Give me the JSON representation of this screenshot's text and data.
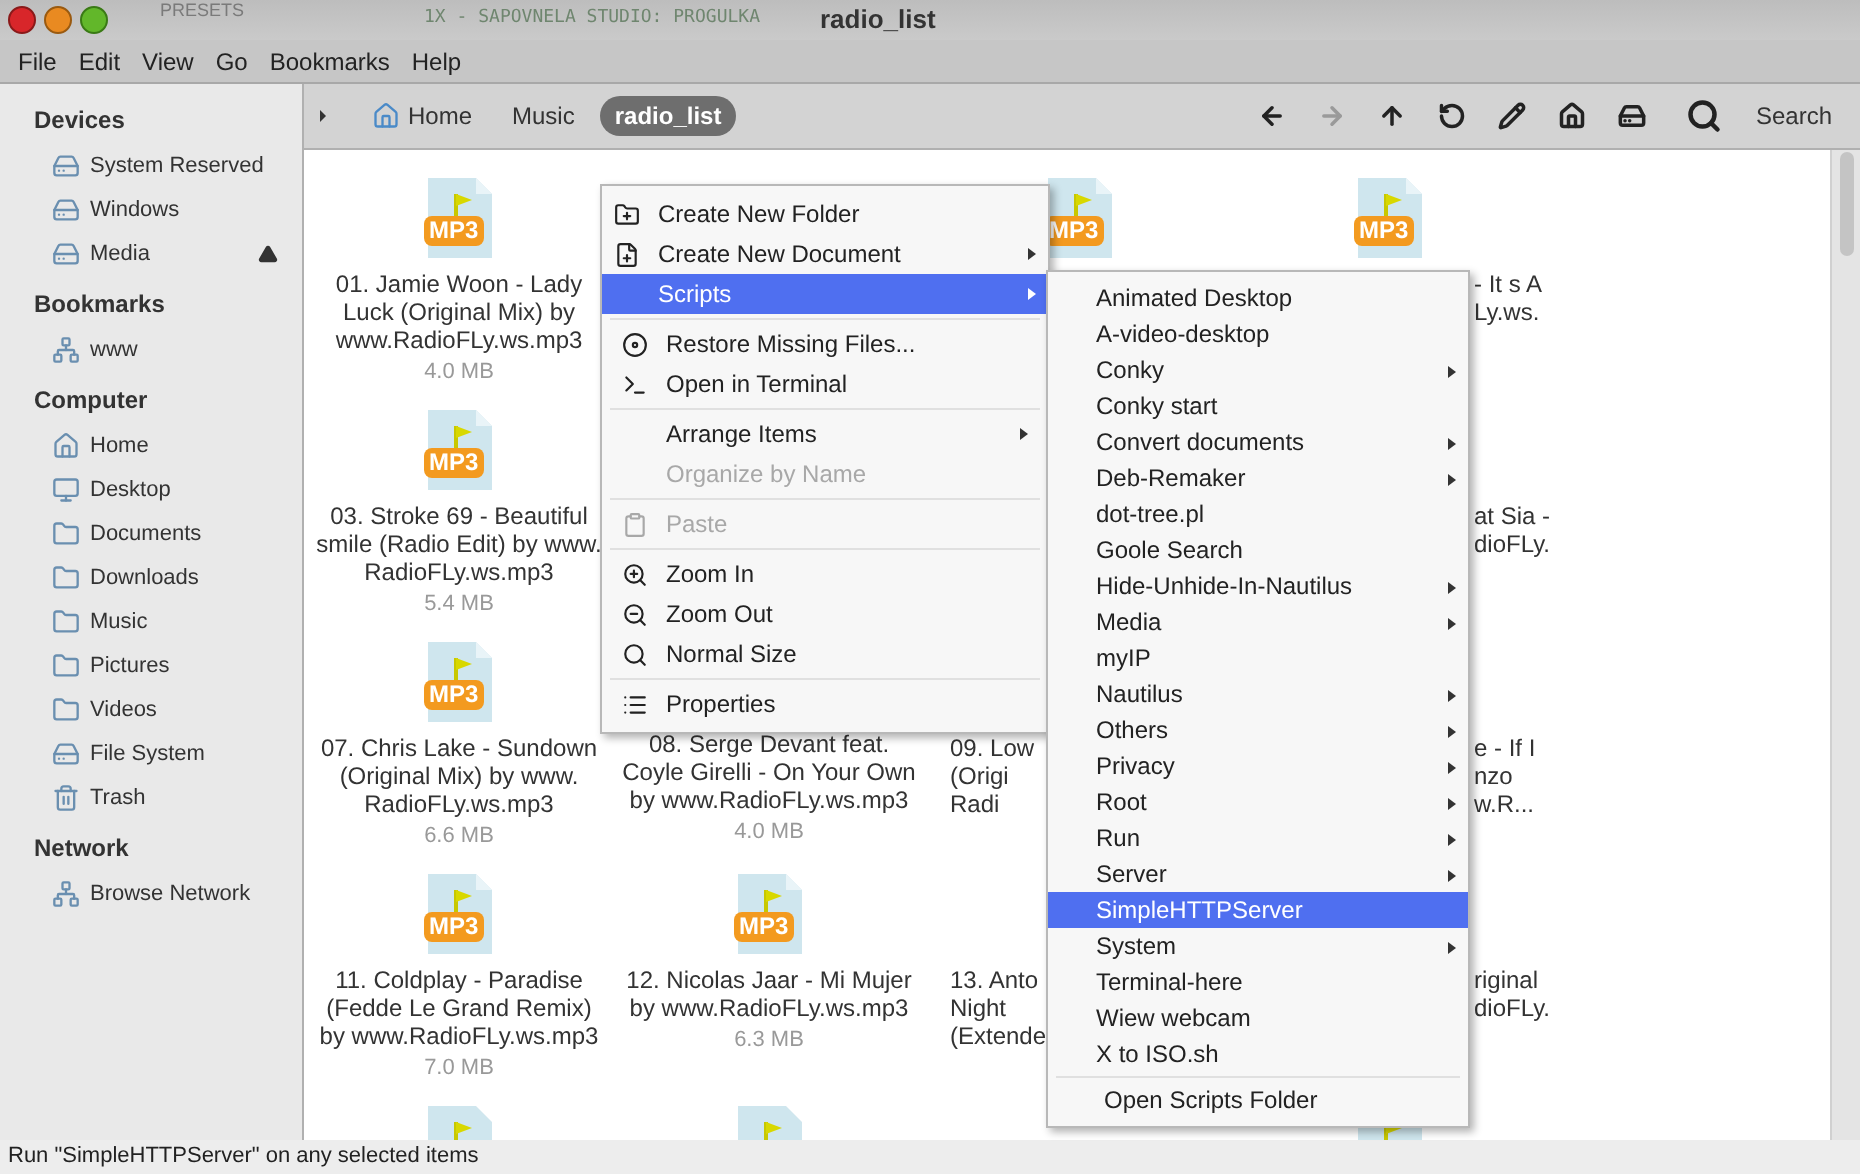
{
  "background_window": {
    "texts": [
      "PRESETS",
      "1X - SAPOVNELA STUDIO: PROGULKA"
    ]
  },
  "window": {
    "title": "radio_list"
  },
  "menubar": [
    "File",
    "Edit",
    "View",
    "Go",
    "Bookmarks",
    "Help"
  ],
  "sidebar": {
    "sections": [
      {
        "title": "Devices",
        "items": [
          {
            "label": "System Reserved",
            "kind": "drive",
            "eject": false
          },
          {
            "label": "Windows",
            "kind": "drive",
            "eject": false
          },
          {
            "label": "Media",
            "kind": "drive",
            "eject": true
          }
        ]
      },
      {
        "title": "Bookmarks",
        "items": [
          {
            "label": "www",
            "kind": "network",
            "eject": false
          }
        ]
      },
      {
        "title": "Computer",
        "items": [
          {
            "label": "Home",
            "kind": "home",
            "eject": false
          },
          {
            "label": "Desktop",
            "kind": "desktop",
            "eject": false
          },
          {
            "label": "Documents",
            "kind": "folder",
            "eject": false
          },
          {
            "label": "Downloads",
            "kind": "folder",
            "eject": false
          },
          {
            "label": "Music",
            "kind": "folder",
            "eject": false
          },
          {
            "label": "Pictures",
            "kind": "folder",
            "eject": false
          },
          {
            "label": "Videos",
            "kind": "folder",
            "eject": false
          },
          {
            "label": "File System",
            "kind": "drive",
            "eject": false
          },
          {
            "label": "Trash",
            "kind": "trash",
            "eject": false
          }
        ]
      },
      {
        "title": "Network",
        "items": [
          {
            "label": "Browse Network",
            "kind": "network",
            "eject": false
          }
        ]
      }
    ]
  },
  "breadcrumbs": [
    {
      "label": "Home",
      "selected": false
    },
    {
      "label": "Music",
      "selected": false
    },
    {
      "label": "radio_list",
      "selected": true
    }
  ],
  "toolbar": {
    "buttons": [
      {
        "kind": "back",
        "disabled": false
      },
      {
        "kind": "forward",
        "disabled": true
      },
      {
        "kind": "up",
        "disabled": false
      },
      {
        "kind": "reload",
        "disabled": false
      },
      {
        "kind": "edit",
        "disabled": false
      },
      {
        "kind": "home",
        "disabled": false
      },
      {
        "kind": "drive",
        "disabled": false
      }
    ],
    "search_label": "Search"
  },
  "files": [
    [
      {
        "kind": "full",
        "badge": "MP3",
        "name": "01. Jamie Woon - Lady\nLuck (Original Mix) by\nwww.RadioFLy.ws.mp3",
        "size": "4.0 MB"
      },
      {
        "kind": "full"
      },
      {
        "kind": "full",
        "badge": "MP3"
      },
      {
        "kind": "tail",
        "badge": "MP3",
        "name": "- It s A\nLy.ws."
      }
    ],
    [
      {
        "kind": "full",
        "badge": "MP3",
        "name": "03. Stroke 69 - Beautiful\nsmile (Radio Edit) by www.\nRadioFLy.ws.mp3",
        "size": "5.4 MB"
      },
      {
        "kind": "full"
      },
      {
        "kind": "full"
      },
      {
        "kind": "tail",
        "name": "at Sia -\ndioFLy."
      }
    ],
    [
      {
        "kind": "full",
        "badge": "MP3",
        "name": "07. Chris Lake - Sundown\n(Original Mix) by www.\nRadioFLy.ws.mp3",
        "size": "6.6 MB"
      },
      {
        "kind": "full",
        "name": "08. Serge Devant feat.\nCoyle Girelli - On Your Own\nby www.RadioFLy.ws.mp3",
        "size": "4.0 MB"
      },
      {
        "kind": "head",
        "name": "09. Low\n(Origi\nRadi"
      },
      {
        "kind": "tail",
        "name": "e - If I\nnzo\nw.R..."
      }
    ],
    [
      {
        "kind": "full",
        "badge": "MP3",
        "name": "11. Coldplay - Paradise\n(Fedde Le Grand Remix)\nby www.RadioFLy.ws.mp3",
        "size": "7.0 MB"
      },
      {
        "kind": "full",
        "badge": "MP3",
        "name": "12. Nicolas Jaar - Mi Mujer\nby www.RadioFLy.ws.mp3",
        "size": "6.3 MB"
      },
      {
        "kind": "head",
        "name": "13. Anto\nNight\n(Extende"
      },
      {
        "kind": "tail",
        "name": "riginal\ndioFLy."
      }
    ],
    [
      {
        "kind": "icon-top"
      },
      {
        "kind": "icon-top"
      },
      {
        "kind": "full"
      },
      {
        "kind": "icon-top"
      }
    ]
  ],
  "context_menu": {
    "groups": [
      [
        {
          "label": "Create New Folder",
          "kind": "new-folder",
          "submenu": false,
          "selected": false,
          "disabled": false
        },
        {
          "label": "Create New Document",
          "kind": "new-document",
          "submenu": true,
          "selected": false,
          "disabled": false
        },
        {
          "label": "Scripts",
          "kind": "plain",
          "submenu": true,
          "selected": true,
          "disabled": false
        }
      ],
      [
        {
          "label": "Restore Missing Files...",
          "kind": "restore",
          "submenu": false,
          "selected": false,
          "disabled": false
        },
        {
          "label": "Open in Terminal",
          "kind": "terminal",
          "submenu": false,
          "selected": false,
          "disabled": false
        }
      ],
      [
        {
          "label": "Arrange Items",
          "kind": "plain",
          "submenu": true,
          "selected": false,
          "disabled": false
        },
        {
          "label": "Organize by Name",
          "kind": "plain",
          "submenu": false,
          "selected": false,
          "disabled": true
        }
      ],
      [
        {
          "label": "Paste",
          "kind": "paste",
          "submenu": false,
          "selected": false,
          "disabled": true
        }
      ],
      [
        {
          "label": "Zoom In",
          "kind": "zoom-in",
          "submenu": false,
          "selected": false,
          "disabled": false
        },
        {
          "label": "Zoom Out",
          "kind": "zoom-out",
          "submenu": false,
          "selected": false,
          "disabled": false
        },
        {
          "label": "Normal Size",
          "kind": "zoom-reset",
          "submenu": false,
          "selected": false,
          "disabled": false
        }
      ],
      [
        {
          "label": "Properties",
          "kind": "properties",
          "submenu": false,
          "selected": false,
          "disabled": false
        }
      ]
    ]
  },
  "scripts_menu": {
    "groups": [
      [
        {
          "label": "Animated Desktop",
          "submenu": false,
          "selected": false
        },
        {
          "label": "A-video-desktop",
          "submenu": false,
          "selected": false
        },
        {
          "label": "Conky",
          "submenu": true,
          "selected": false
        },
        {
          "label": "Conky start",
          "submenu": false,
          "selected": false
        },
        {
          "label": "Convert documents",
          "submenu": true,
          "selected": false
        },
        {
          "label": "Deb-Remaker",
          "submenu": true,
          "selected": false
        },
        {
          "label": "dot-tree.pl",
          "submenu": false,
          "selected": false
        },
        {
          "label": "Goole Search",
          "submenu": false,
          "selected": false
        },
        {
          "label": "Hide-Unhide-In-Nautilus",
          "submenu": true,
          "selected": false
        },
        {
          "label": "Media",
          "submenu": true,
          "selected": false
        },
        {
          "label": "myIP",
          "submenu": false,
          "selected": false
        },
        {
          "label": "Nautilus",
          "submenu": true,
          "selected": false
        },
        {
          "label": "Others",
          "submenu": true,
          "selected": false
        },
        {
          "label": "Privacy",
          "submenu": true,
          "selected": false
        },
        {
          "label": "Root",
          "submenu": true,
          "selected": false
        },
        {
          "label": "Run",
          "submenu": true,
          "selected": false
        },
        {
          "label": "Server",
          "submenu": true,
          "selected": false
        },
        {
          "label": "SimpleHTTPServer",
          "submenu": false,
          "selected": true
        },
        {
          "label": "System",
          "submenu": true,
          "selected": false
        },
        {
          "label": "Terminal-here",
          "submenu": false,
          "selected": false
        },
        {
          "label": "Wiew webcam",
          "submenu": false,
          "selected": false
        },
        {
          "label": "X to ISO.sh",
          "submenu": false,
          "selected": false
        }
      ],
      [
        {
          "label": "Open Scripts Folder",
          "submenu": false,
          "selected": false
        }
      ]
    ]
  },
  "status_bar": "Run \"SimpleHTTPServer\" on any selected items"
}
